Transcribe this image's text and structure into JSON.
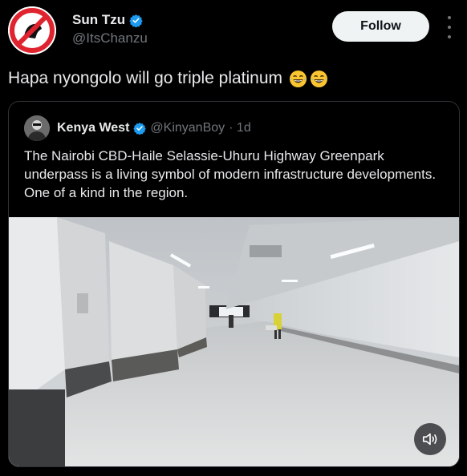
{
  "author": {
    "display_name": "Sun Tzu",
    "handle": "@ItsChanzu",
    "avatar": "no-symbol-avatar-icon",
    "verified": "blue-check-icon"
  },
  "actions": {
    "follow_label": "Follow",
    "more": "more-vertical-icon"
  },
  "tweet": {
    "text": "Hapa nyongolo will go triple platinum",
    "emojis": [
      "laughing-emoji",
      "laughing-emoji"
    ]
  },
  "quoted": {
    "display_name": "Kenya West",
    "handle": "@KinyanBoy",
    "separator_time": "· 1d",
    "text": "The Nairobi CBD-Haile Selassie-Uhuru Highway Greenpark underpass is a living symbol of modern infrastructure developments. One of a kind in the region.",
    "media": "underpass-tunnel-video",
    "sound_control": "speaker-muted-icon"
  },
  "colors": {
    "background": "#000000",
    "text": "#e7e9ea",
    "secondary": "#71767b",
    "verified_blue": "#1d9bf0",
    "follow_bg": "#eff3f4",
    "border": "#2f3336"
  }
}
